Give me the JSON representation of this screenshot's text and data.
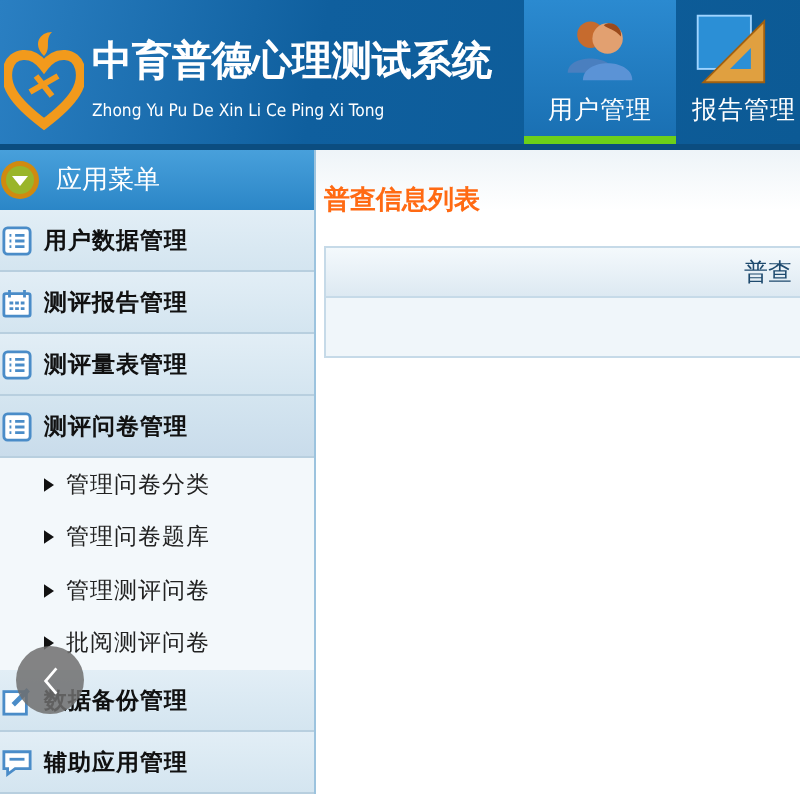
{
  "header": {
    "title": "中育普德心理测试系统",
    "subtitle": "Zhong Yu Pu De Xin Li Ce Ping Xi Tong"
  },
  "nav_tabs": [
    {
      "label": "用户管理",
      "kind": "users",
      "selected": true
    },
    {
      "label": "报告管理",
      "kind": "ruler",
      "selected": false
    }
  ],
  "sidebar": {
    "title": "应用菜单",
    "items": [
      {
        "label": "用户数据管理",
        "kind": "list",
        "expanded": false
      },
      {
        "label": "测评报告管理",
        "kind": "calendar",
        "expanded": false
      },
      {
        "label": "测评量表管理",
        "kind": "list",
        "expanded": false
      },
      {
        "label": "测评问卷管理",
        "kind": "list",
        "expanded": true,
        "children": [
          {
            "label": "管理问卷分类"
          },
          {
            "label": "管理问卷题库"
          },
          {
            "label": "管理测评问卷"
          },
          {
            "label": "批阅测评问卷"
          }
        ]
      },
      {
        "label": "数据备份管理",
        "kind": "edit",
        "expanded": false
      },
      {
        "label": "辅助应用管理",
        "kind": "chat",
        "expanded": false
      }
    ]
  },
  "content": {
    "title": "普查信息列表",
    "table": {
      "columns": [
        "普查"
      ]
    }
  }
}
